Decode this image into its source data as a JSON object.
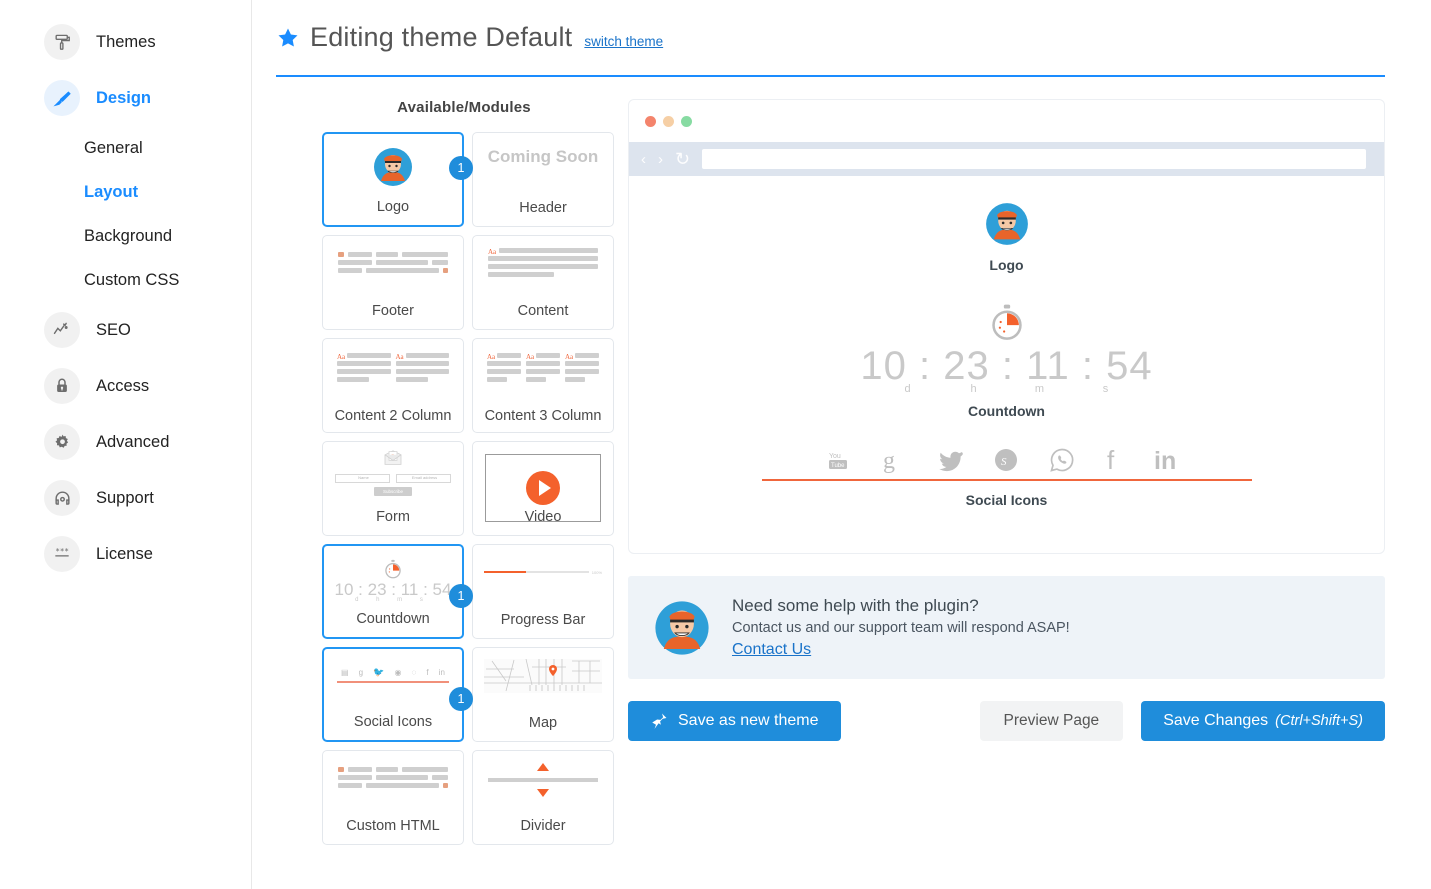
{
  "sidebar": {
    "items": [
      {
        "label": "Themes",
        "icon": "roller-brush-icon",
        "active": false
      },
      {
        "label": "Design",
        "icon": "paint-brush-icon",
        "active": true
      },
      {
        "label": "SEO",
        "icon": "chart-line-icon",
        "active": false
      },
      {
        "label": "Access",
        "icon": "lock-icon",
        "active": false
      },
      {
        "label": "Advanced",
        "icon": "gear-icon",
        "active": false
      },
      {
        "label": "Support",
        "icon": "headset-icon",
        "active": false
      },
      {
        "label": "License",
        "icon": "license-key-icon",
        "active": false
      }
    ],
    "design_subitems": [
      {
        "label": "General",
        "active": false
      },
      {
        "label": "Layout",
        "active": true
      },
      {
        "label": "Background",
        "active": false
      },
      {
        "label": "Custom CSS",
        "active": false
      }
    ]
  },
  "header": {
    "title": "Editing theme Default",
    "switch_link": "switch theme",
    "star_icon": "star-icon",
    "accent_color": "#1a8cff"
  },
  "modules": {
    "title": "Available/Modules",
    "cards": [
      {
        "name": "Logo",
        "selected": true,
        "badge": "1",
        "thumb": "logo-avatar",
        "coming_soon": false
      },
      {
        "name": "Header",
        "selected": false,
        "badge": null,
        "thumb": "coming-soon",
        "coming_soon": true,
        "coming_soon_text": "Coming Soon"
      },
      {
        "name": "Footer",
        "selected": false,
        "badge": null,
        "thumb": "code-bars",
        "coming_soon": false
      },
      {
        "name": "Content",
        "selected": false,
        "badge": null,
        "thumb": "text-block",
        "coming_soon": false
      },
      {
        "name": "Content 2 Column",
        "selected": false,
        "badge": null,
        "thumb": "text-2col",
        "coming_soon": false
      },
      {
        "name": "Content 3 Column",
        "selected": false,
        "badge": null,
        "thumb": "text-3col",
        "coming_soon": false
      },
      {
        "name": "Form",
        "selected": false,
        "badge": null,
        "thumb": "form",
        "coming_soon": false
      },
      {
        "name": "Video",
        "selected": false,
        "badge": null,
        "thumb": "video",
        "coming_soon": false
      },
      {
        "name": "Countdown",
        "selected": true,
        "badge": "1",
        "thumb": "countdown",
        "coming_soon": false
      },
      {
        "name": "Progress Bar",
        "selected": false,
        "badge": null,
        "thumb": "progress",
        "coming_soon": false
      },
      {
        "name": "Social Icons",
        "selected": true,
        "badge": "1",
        "thumb": "social",
        "coming_soon": false
      },
      {
        "name": "Map",
        "selected": false,
        "badge": null,
        "thumb": "map",
        "coming_soon": false
      },
      {
        "name": "Custom HTML",
        "selected": false,
        "badge": null,
        "thumb": "code-bars",
        "coming_soon": false
      },
      {
        "name": "Divider",
        "selected": false,
        "badge": null,
        "thumb": "divider",
        "coming_soon": false
      }
    ],
    "form_thumb": {
      "name_placeholder": "Name",
      "email_placeholder": "Email address",
      "button": "Subscribe"
    },
    "progress_thumb": {
      "percent_label": "100%"
    },
    "countdown_thumb": {
      "value": "10 : 23 : 11 : 54",
      "units": "d   h   m   s"
    }
  },
  "preview": {
    "address_value": "",
    "dots": [
      "#f4846c",
      "#f6cfa5",
      "#87dba2"
    ],
    "nav_back": "‹",
    "nav_forward": "›",
    "reload": "↻",
    "blocks": [
      {
        "label": "Logo"
      },
      {
        "label": "Countdown"
      },
      {
        "label": "Social Icons"
      }
    ],
    "countdown": {
      "days": "10",
      "hours": "23",
      "minutes": "11",
      "seconds": "54",
      "unit_d": "d",
      "unit_h": "h",
      "unit_m": "m",
      "unit_s": "s",
      "separator": ":"
    },
    "social_icons": [
      "youtube-icon",
      "google-plus-icon",
      "twitter-icon",
      "skype-icon",
      "whatsapp-icon",
      "facebook-icon",
      "linkedin-icon"
    ],
    "accent_color": "#f0663c"
  },
  "help": {
    "title": "Need some help with the plugin?",
    "subtitle": "Contact us and our support team will respond ASAP!",
    "link": "Contact Us",
    "avatar": "mascot-avatar"
  },
  "actions": {
    "save_as_new": "Save as new theme",
    "save_as_new_icon": "pin-icon",
    "preview_page": "Preview Page",
    "save_changes": "Save Changes",
    "save_changes_shortcut": "(Ctrl+Shift+S)"
  }
}
